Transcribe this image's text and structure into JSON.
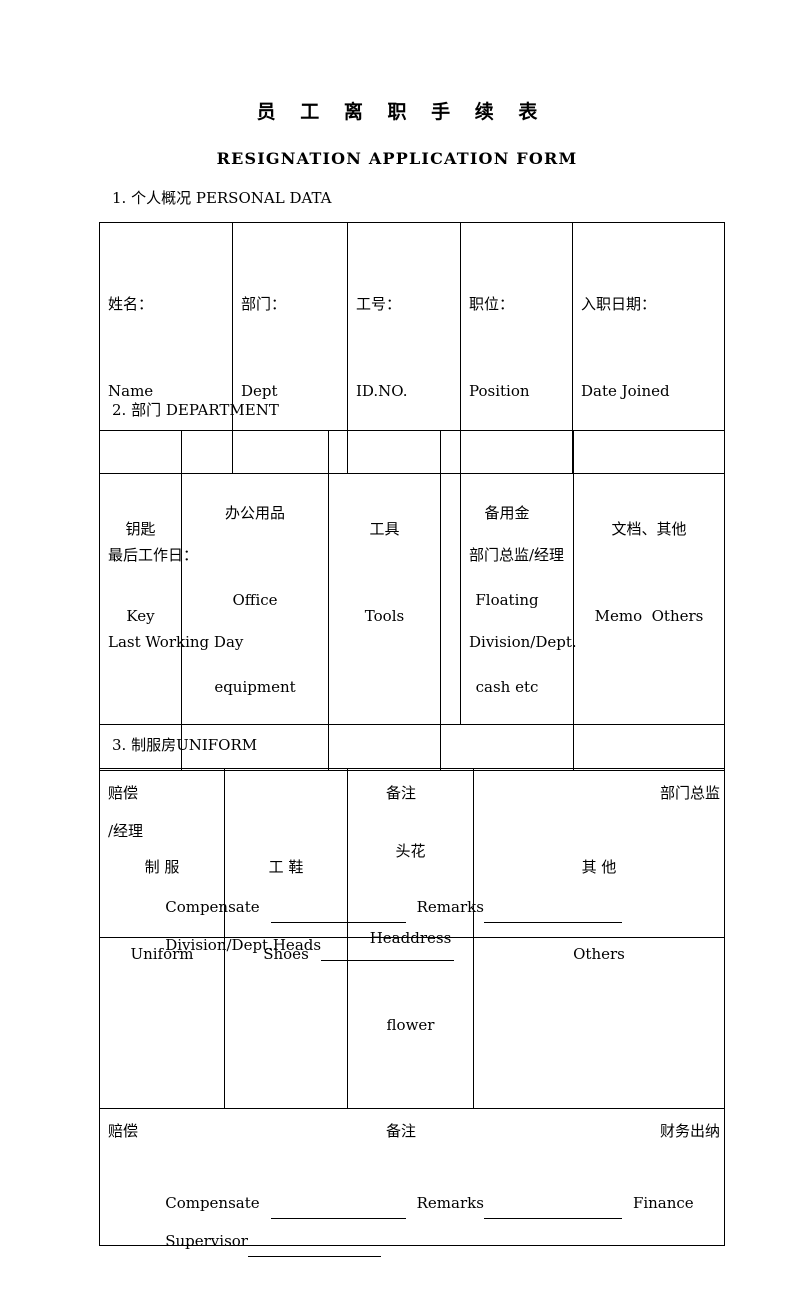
{
  "document": {
    "title_cn": "员 工 离 职 手 续 表",
    "title_en": "RESIGNATION APPLICATION FORM"
  },
  "sections": [
    {
      "heading": "1. 个人概况 PERSONAL DATA",
      "table": {
        "row1": [
          {
            "cn": "姓名：",
            "en": "Name"
          },
          {
            "cn": "部门：",
            "en": "Dept"
          },
          {
            "cn": "工号：",
            "en": "ID.NO."
          },
          {
            "cn": "职位：",
            "en": "Position"
          },
          {
            "cn": "入职日期：",
            "en": "Date Joined"
          }
        ],
        "row2": [
          {
            "cn": "最后工作日：",
            "en": "Last Working Day"
          },
          {
            "cn": "部门总监/经理",
            "en": "Division/Dept."
          }
        ]
      }
    },
    {
      "heading": "2. 部门 DEPARTMENT",
      "table": {
        "headers": [
          {
            "cn": "钥匙",
            "en1": "Key",
            "en2": ""
          },
          {
            "cn": "办公用品",
            "en1": "Office",
            "en2": "equipment"
          },
          {
            "cn": "工具",
            "en1": "Tools",
            "en2": ""
          },
          {
            "cn": "备用金",
            "en1": "Floating",
            "en2": "cash etc"
          },
          {
            "cn": "文档、其他",
            "en1": "Memo  Others",
            "en2": ""
          }
        ],
        "footer": {
          "cn_left": "赔偿",
          "cn_mid": "备注",
          "cn_right": "部门总监",
          "cn_right2": "/经理",
          "en_compensate": "Compensate",
          "en_remarks": "Remarks",
          "en_signer": "Division/Dept.Heads"
        }
      }
    },
    {
      "heading": "3. 制服房UNIFORM",
      "table": {
        "headers": [
          {
            "cn": "制 服",
            "en1": "Uniform",
            "en2": ""
          },
          {
            "cn": "工 鞋",
            "en1": "Shoes",
            "en2": ""
          },
          {
            "cn": "头花",
            "en1": "Headdress",
            "en2": "flower"
          },
          {
            "cn": "其 他",
            "en1": "Others",
            "en2": ""
          }
        ],
        "footer": {
          "cn_left": "赔偿",
          "cn_mid": "备注",
          "cn_right": "财务出纳",
          "en_compensate": "Compensate",
          "en_remarks": "Remarks",
          "en_finance": "Finance",
          "en_signer": "Supervisor"
        }
      }
    }
  ]
}
